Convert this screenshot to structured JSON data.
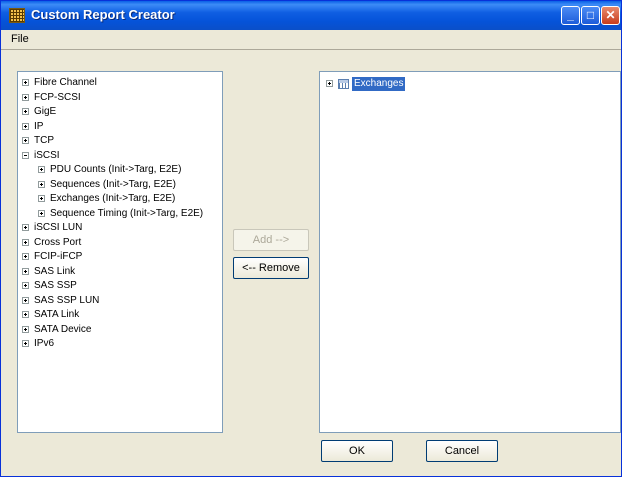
{
  "window": {
    "title": "Custom Report Creator"
  },
  "menu": {
    "file": "File"
  },
  "left_tree": {
    "items": [
      "Fibre Channel",
      "FCP-SCSI",
      "GigE",
      "IP",
      "TCP",
      "iSCSI",
      "PDU Counts (Init->Targ, E2E)",
      "Sequences (Init->Targ, E2E)",
      "Exchanges (Init->Targ, E2E)",
      "Sequence Timing (Init->Targ, E2E)",
      "iSCSI LUN",
      "Cross Port",
      "FCIP-iFCP",
      "SAS Link",
      "SAS SSP",
      "SAS SSP LUN",
      "SATA Link",
      "SATA Device",
      "IPv6"
    ]
  },
  "right_tree": {
    "items": [
      "Exchanges"
    ]
  },
  "buttons": {
    "add": "Add -->",
    "remove": "<-- Remove",
    "ok": "OK",
    "cancel": "Cancel"
  },
  "colors": {
    "selection": "#316ac5",
    "titlebar": "#0553d9"
  }
}
